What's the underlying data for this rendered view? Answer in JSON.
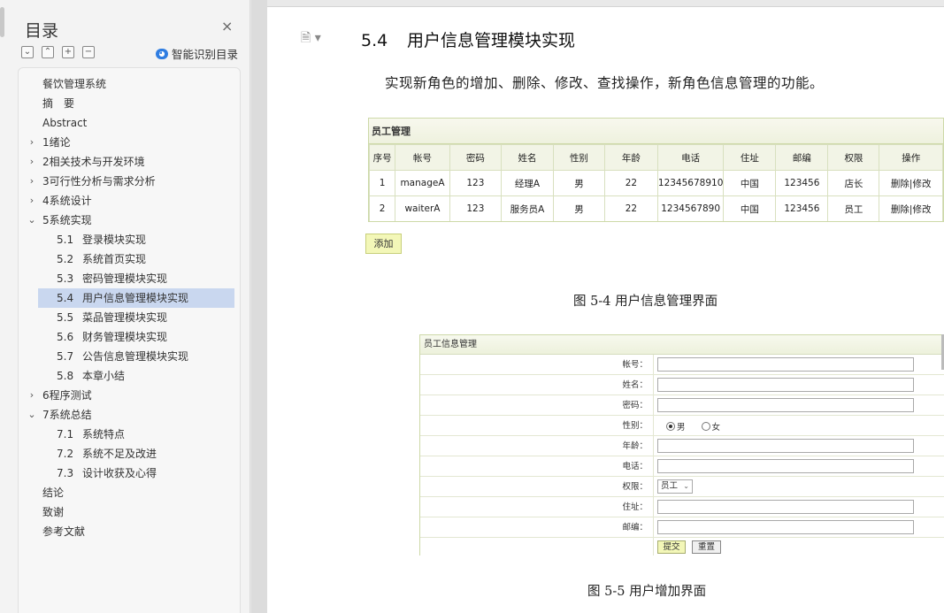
{
  "sidebar": {
    "title": "目录",
    "close_icon": "×",
    "tools": [
      "⌄",
      "⌃",
      "+",
      "−"
    ],
    "smart_toc_label": "智能识别目录",
    "items": [
      {
        "label": "餐饮管理系统",
        "level": 1,
        "chevron": ""
      },
      {
        "label": "摘　要",
        "level": 1,
        "chevron": ""
      },
      {
        "label": "Abstract",
        "level": 1,
        "chevron": ""
      },
      {
        "label": "1绪论",
        "level": 1,
        "chevron": "›"
      },
      {
        "label": "2相关技术与开发环境",
        "level": 1,
        "chevron": "›"
      },
      {
        "label": "3可行性分析与需求分析",
        "level": 1,
        "chevron": "›"
      },
      {
        "label": "4系统设计",
        "level": 1,
        "chevron": "›"
      },
      {
        "label": "5系统实现",
        "level": 1,
        "chevron": "⌄"
      },
      {
        "num": "5.1",
        "label": "登录模块实现",
        "level": 2
      },
      {
        "num": "5.2",
        "label": "系统首页实现",
        "level": 2
      },
      {
        "num": "5.3",
        "label": "密码管理模块实现",
        "level": 2
      },
      {
        "num": "5.4",
        "label": "用户信息管理模块实现",
        "level": 2,
        "active": true
      },
      {
        "num": "5.5",
        "label": "菜品管理模块实现",
        "level": 2
      },
      {
        "num": "5.6",
        "label": "财务管理模块实现",
        "level": 2
      },
      {
        "num": "5.7",
        "label": "公告信息管理模块实现",
        "level": 2
      },
      {
        "num": "5.8",
        "label": "本章小结",
        "level": 2
      },
      {
        "label": "6程序测试",
        "level": 1,
        "chevron": "›"
      },
      {
        "label": "7系统总结",
        "level": 1,
        "chevron": "⌄"
      },
      {
        "num": "7.1",
        "label": "系统特点",
        "level": 2
      },
      {
        "num": "7.2",
        "label": "系统不足及改进",
        "level": 2
      },
      {
        "num": "7.3",
        "label": "设计收获及心得",
        "level": 2
      },
      {
        "label": "结论",
        "level": 1,
        "chevron": ""
      },
      {
        "label": "致谢",
        "level": 1,
        "chevron": ""
      },
      {
        "label": "参考文献",
        "level": 1,
        "chevron": ""
      }
    ]
  },
  "document": {
    "icon": "🗎 ▾",
    "section_num": "5.4",
    "section_title": "用户信息管理模块实现",
    "paragraph": "实现新角色的增加、删除、修改、查找操作，新角色信息管理的功能。",
    "figure1": {
      "title": "员工管理",
      "headers": [
        "序号",
        "帐号",
        "密码",
        "姓名",
        "性别",
        "年龄",
        "电话",
        "住址",
        "邮编",
        "权限",
        "操作"
      ],
      "rows": [
        [
          "1",
          "manageA",
          "123",
          "经理A",
          "男",
          "22",
          "12345678910",
          "中国",
          "123456",
          "店长",
          "删除|修改"
        ],
        [
          "2",
          "waiterA",
          "123",
          "服务员A",
          "男",
          "22",
          "1234567890",
          "中国",
          "123456",
          "员工",
          "删除|修改"
        ]
      ],
      "add_button": "添加",
      "caption": "图 5-4 用户信息管理界面"
    },
    "figure2": {
      "title": "员工信息管理",
      "fields": {
        "account": "帐号：",
        "name": "姓名：",
        "password": "密码：",
        "gender": "性别：",
        "age": "年龄：",
        "phone": "电话：",
        "role": "权限：",
        "address": "住址：",
        "zip": "邮编："
      },
      "gender_options": {
        "male": "男",
        "female": "女"
      },
      "role_value": "员工",
      "submit": "提交",
      "reset": "重置",
      "caption": "图 5-5 用户增加界面"
    }
  }
}
